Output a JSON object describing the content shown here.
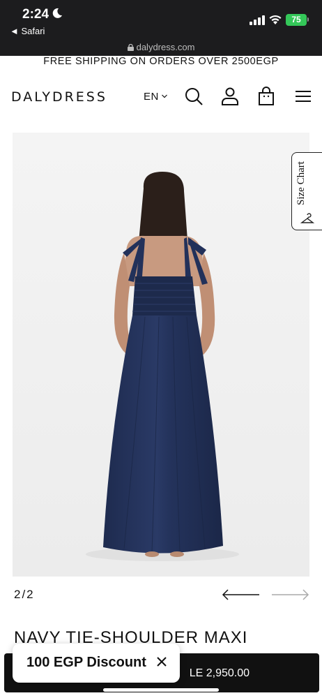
{
  "status_bar": {
    "time": "2:24",
    "back_label": "◄ Safari",
    "battery": "75",
    "url": "dalydress.com"
  },
  "banner": {
    "text": "FREE SHIPPING ON ORDERS OVER 2500EGP"
  },
  "header": {
    "logo": "DALYDRESS",
    "language": "EN",
    "icons": [
      "search-icon",
      "account-icon",
      "bag-icon",
      "menu-icon"
    ]
  },
  "gallery": {
    "size_chart_label": "Size Chart",
    "counter": "2/2",
    "product_image": "navy-dress-back-view"
  },
  "product": {
    "title": "NAVY TIE-SHOULDER MAXI",
    "price": "LE 2,950.00"
  },
  "discount_popup": {
    "label": "100 EGP Discount"
  },
  "colors": {
    "status_bg": "#1c1c1e",
    "dress_navy": "#22315a",
    "battery": "#34c759"
  }
}
